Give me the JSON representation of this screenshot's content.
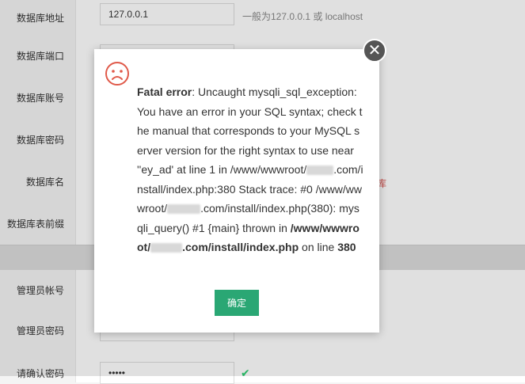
{
  "form": {
    "db_host": {
      "label": "数据库地址",
      "value": "127.0.0.1",
      "hint": "一般为127.0.0.1 或 localhost"
    },
    "db_port": {
      "label": "数据库端口"
    },
    "db_user": {
      "label": "数据库账号"
    },
    "db_pass": {
      "label": "数据库密码"
    },
    "db_name": {
      "label": "数据库名",
      "error_fragment": "库"
    },
    "db_prefix": {
      "label": "数据库表前缀"
    },
    "admin_user": {
      "label": "管理员帐号"
    },
    "admin_pass": {
      "label": "管理员密码"
    },
    "confirm_pass": {
      "label": "请确认密码",
      "value": "•••••",
      "check": "✔"
    }
  },
  "dialog": {
    "title_bold": "Fatal error",
    "message_1": ": Uncaught mysqli_sql_exception: You have an error in your SQL syntax; check the manual that corresponds to your MySQL server version for the right syntax to use near ''ey_ad' at line 1 in /www/wwwroot/",
    "message_2": ".com/install/index.php:380 Stack trace: #0 /www/wwwroot/",
    "message_3": ".com/install/index.php(380): mysqli_query() #1 {main} thrown in ",
    "path_bold_1": "/www/wwwroot/",
    "path_bold_2": ".com/install/index.php",
    "line_text": " on line ",
    "line_number": "380",
    "ok_label": "确定",
    "close_glyph": "✕"
  },
  "colors": {
    "accent": "#2aa774",
    "error": "#d9534f",
    "close_bg": "#555555"
  }
}
